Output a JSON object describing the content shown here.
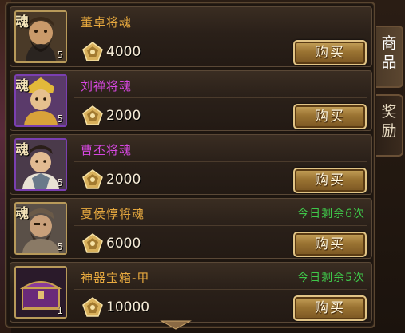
{
  "shop": {
    "items": [
      {
        "soul_glyph": "魂",
        "name": "董卓将魂",
        "count": "5",
        "price": "4000",
        "buy_label": "购买",
        "limit": "",
        "name_color": "gold",
        "frame": "gold"
      },
      {
        "soul_glyph": "魂",
        "name": "刘禅将魂",
        "count": "5",
        "price": "2000",
        "buy_label": "购买",
        "limit": "",
        "name_color": "purple",
        "frame": "purple"
      },
      {
        "soul_glyph": "魂",
        "name": "曹丕将魂",
        "count": "5",
        "price": "2000",
        "buy_label": "购买",
        "limit": "",
        "name_color": "purple",
        "frame": "purple"
      },
      {
        "soul_glyph": "魂",
        "name": "夏侯惇将魂",
        "count": "5",
        "price": "6000",
        "buy_label": "购买",
        "limit": "今日剩余6次",
        "name_color": "gold",
        "frame": "gold"
      },
      {
        "soul_glyph": "",
        "name": "神器宝箱-甲",
        "count": "1",
        "price": "10000",
        "buy_label": "购买",
        "limit": "今日剩余5次",
        "name_color": "gold",
        "frame": "gold"
      }
    ]
  },
  "tabs": [
    {
      "label": "商品",
      "active": true
    },
    {
      "label": "奖励",
      "active": false
    }
  ],
  "icons": {
    "currency": "pentagon-coin-icon",
    "scroll": "chevron-down-icon"
  },
  "colors": {
    "name_gold": "#e7a93f",
    "name_purple": "#d748e2",
    "limit_green": "#3fc84a"
  }
}
